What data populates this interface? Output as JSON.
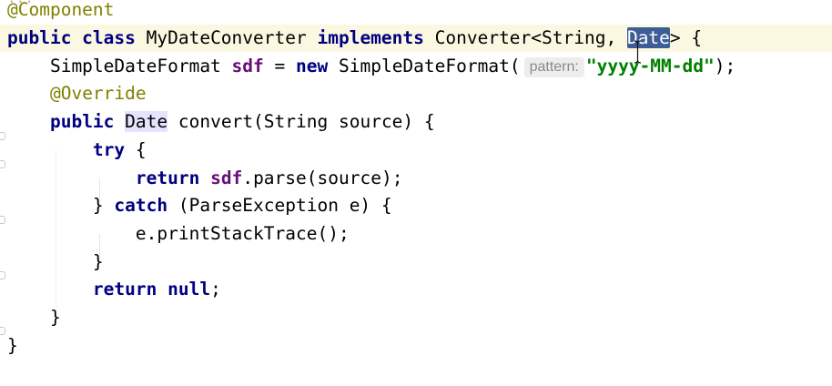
{
  "top_fragment": "...",
  "code_lines": [
    {
      "id": "l1",
      "tokens": [
        {
          "t": "@Component",
          "c": "ann"
        }
      ]
    },
    {
      "id": "l2",
      "tokens": [
        {
          "t": "public class",
          "c": "kw"
        },
        {
          "t": " MyDateConverter ",
          "c": ""
        },
        {
          "t": "implements",
          "c": "kw"
        },
        {
          "t": " Converter<String, ",
          "c": ""
        },
        {
          "t": "Date",
          "c": "sel"
        },
        {
          "t": "> {",
          "c": ""
        }
      ]
    },
    {
      "id": "l3",
      "tokens": [
        {
          "t": "    SimpleDateFormat ",
          "c": ""
        },
        {
          "t": "sdf",
          "c": "field"
        },
        {
          "t": " = ",
          "c": ""
        },
        {
          "t": "new",
          "c": "kw"
        },
        {
          "t": " SimpleDateFormat(",
          "c": ""
        },
        {
          "t": "pattern:",
          "c": "hint"
        },
        {
          "t": "\"yyyy-MM-dd\"",
          "c": "str"
        },
        {
          "t": ");",
          "c": ""
        }
      ]
    },
    {
      "id": "l4",
      "tokens": [
        {
          "t": "    ",
          "c": ""
        },
        {
          "t": "@Override",
          "c": "ann"
        }
      ]
    },
    {
      "id": "l5",
      "tokens": [
        {
          "t": "    ",
          "c": ""
        },
        {
          "t": "public",
          "c": "kw"
        },
        {
          "t": " ",
          "c": ""
        },
        {
          "t": "Date",
          "c": "usage"
        },
        {
          "t": " convert(String source) {",
          "c": ""
        }
      ]
    },
    {
      "id": "l6",
      "tokens": [
        {
          "t": "        ",
          "c": ""
        },
        {
          "t": "try",
          "c": "kw"
        },
        {
          "t": " {",
          "c": ""
        }
      ]
    },
    {
      "id": "l7",
      "tokens": [
        {
          "t": "            ",
          "c": ""
        },
        {
          "t": "return",
          "c": "kw"
        },
        {
          "t": " ",
          "c": ""
        },
        {
          "t": "sdf",
          "c": "field"
        },
        {
          "t": ".parse(source);",
          "c": ""
        }
      ]
    },
    {
      "id": "l8",
      "tokens": [
        {
          "t": "        } ",
          "c": ""
        },
        {
          "t": "catch",
          "c": "kw"
        },
        {
          "t": " (ParseException e) {",
          "c": ""
        }
      ]
    },
    {
      "id": "l9",
      "tokens": [
        {
          "t": "            e.printStackTrace();",
          "c": ""
        }
      ]
    },
    {
      "id": "l10",
      "tokens": [
        {
          "t": "        }",
          "c": ""
        }
      ]
    },
    {
      "id": "l11",
      "tokens": [
        {
          "t": "        ",
          "c": ""
        },
        {
          "t": "return null",
          "c": "kw"
        },
        {
          "t": ";",
          "c": ""
        }
      ]
    },
    {
      "id": "l12",
      "tokens": [
        {
          "t": "    }",
          "c": ""
        }
      ]
    },
    {
      "id": "l13",
      "tokens": [
        {
          "t": "}",
          "c": ""
        }
      ]
    }
  ],
  "current_line": "l2",
  "colors": {
    "keyword": "#000080",
    "annotation": "#808000",
    "field": "#660e7a",
    "string": "#008000",
    "selection": "#3d5d96",
    "usage_highlight": "#e4e4ff",
    "current_line": "#fbf8e1"
  }
}
